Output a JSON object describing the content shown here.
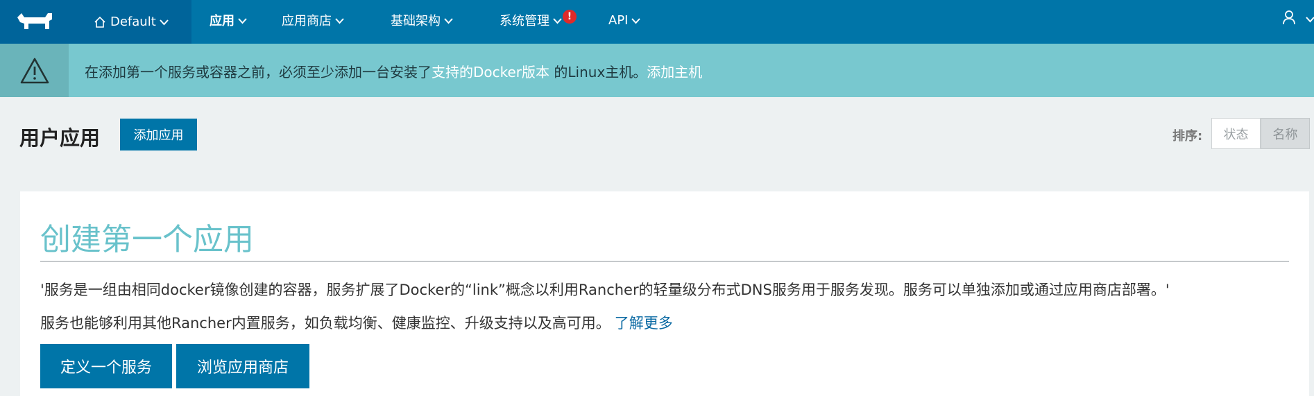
{
  "nav": {
    "environment": "Default",
    "items": [
      {
        "label": "应用",
        "active": true
      },
      {
        "label": "应用商店"
      },
      {
        "label": "基础架构"
      },
      {
        "label": "系统管理",
        "alert": "!"
      },
      {
        "label": "API"
      }
    ]
  },
  "banner": {
    "text_before": "在添加第一个服务或容器之前，必须至少添加一台安装了",
    "link_docker": "支持的Docker版本",
    "text_mid": " 的Linux主机。",
    "link_add_host": "添加主机"
  },
  "page": {
    "title": "用户应用",
    "add_button": "添加应用",
    "sort_label": "排序:",
    "sort_options": [
      "状态",
      "名称"
    ]
  },
  "card": {
    "title": "创建第一个应用",
    "paragraph1": "'服务是一组由相同docker镜像创建的容器，服务扩展了Docker的“link”概念以利用Rancher的轻量级分布式DNS服务用于服务发现。服务可以单独添加或通过应用商店部署。'",
    "paragraph2": "服务也能够利用其他Rancher内置服务，如负载均衡、健康监控、升级支持以及高可用。",
    "learn_more": "了解更多",
    "buttons": [
      "定义一个服务",
      "浏览应用商店"
    ]
  },
  "colors": {
    "nav_bg": "#0075a8",
    "nav_dark": "#00649a",
    "banner_bg": "#78c8cf",
    "title_teal": "#69c2cb",
    "alert_red": "#e02a2a"
  }
}
